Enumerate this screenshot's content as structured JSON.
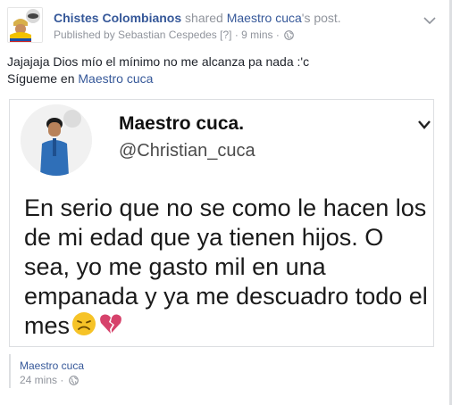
{
  "post": {
    "page_name": "Chistes Colombianos",
    "shared_text": "shared",
    "original_author": "Maestro cuca",
    "post_suffix": "'s post.",
    "published_by": "Published by Sebastian Cespedes",
    "bracket": "[?]",
    "separator": "·",
    "time": "9 mins",
    "text_line1": "Jajajaja Dios mío el mínimo no me alcanza pa nada :'c",
    "text_line2_prefix": "Sígueme en",
    "text_line2_link": "Maestro cuca"
  },
  "tweet": {
    "name": "Maestro cuca.",
    "handle": "@Christian_cuca",
    "body": "En serio que no se como le hacen los de mi edad que ya tienen hijos. O sea, yo me gasto mil en una empanada y ya me descuadro todo el mes"
  },
  "source": {
    "name": "Maestro cuca",
    "time": "24 mins",
    "separator": "·"
  },
  "colors": {
    "link": "#365899",
    "muted": "#90949c",
    "text": "#1d2129"
  }
}
